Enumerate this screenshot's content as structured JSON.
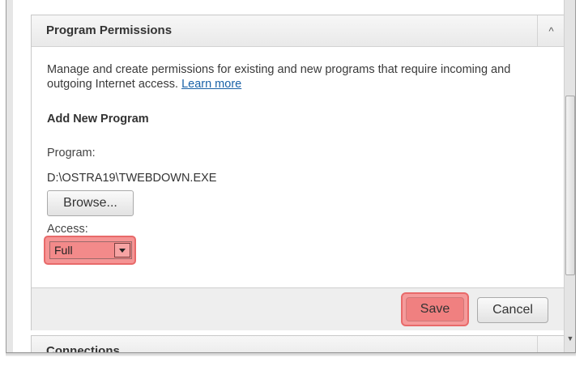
{
  "permissions_panel": {
    "title": "Program Permissions",
    "collapse_glyph": "^",
    "description": "Manage and create permissions for existing and new programs that require incoming and outgoing Internet access.",
    "learn_more": "Learn more",
    "add_section_title": "Add New Program",
    "program_label": "Program:",
    "program_path": "D:\\OSTRA19\\TWEBDOWN.EXE",
    "browse_label": "Browse...",
    "access_label": "Access:",
    "access_value": "Full",
    "save_label": "Save",
    "cancel_label": "Cancel"
  },
  "next_panel": {
    "title": "Connections"
  },
  "scrollbar": {
    "down_glyph": "▼"
  },
  "colors": {
    "highlight": "#f08080",
    "link": "#1a62a8"
  }
}
